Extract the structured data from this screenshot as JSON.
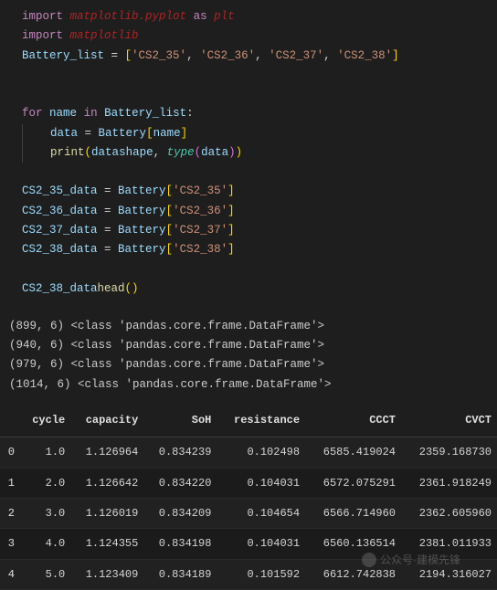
{
  "code": {
    "l1": {
      "import": "import",
      "mod": "matplotlib.pyplot",
      "as": "as",
      "alias": "plt"
    },
    "l2": {
      "import": "import",
      "mod": "matplotlib"
    },
    "l3": {
      "var": "Battery_list",
      "eq": " = ",
      "o": "[",
      "s1": "'CS2_35'",
      "c1": ", ",
      "s2": "'CS2_36'",
      "c2": ", ",
      "s3": "'CS2_37'",
      "c3": ", ",
      "s4": "'CS2_38'",
      "cbr": "]"
    },
    "l4": {
      "for": "for",
      "name": "name",
      "in": "in",
      "iter": "Battery_list",
      ":": ":"
    },
    "l5": {
      "varL": "data",
      "eq": " = ",
      "varR": "Battery",
      "o": "[",
      "idx": "name",
      "c": "]"
    },
    "l6": {
      "fn": "print",
      "o": "(",
      "d": "data",
      ".": ".",
      "attr": "shape",
      ", ": ", ",
      "ty": "type",
      "o2": "(",
      "d2": "data",
      "c2": ")",
      "c": ")"
    },
    "l7": {
      "var": "CS2_35_data",
      "eq": " = ",
      "r": "Battery",
      "o": "[",
      "s": "'CS2_35'",
      "c": "]"
    },
    "l8": {
      "var": "CS2_36_data",
      "eq": " = ",
      "r": "Battery",
      "o": "[",
      "s": "'CS2_36'",
      "c": "]"
    },
    "l9": {
      "var": "CS2_37_data",
      "eq": " = ",
      "r": "Battery",
      "o": "[",
      "s": "'CS2_37'",
      "c": "]"
    },
    "l10": {
      "var": "CS2_38_data",
      "eq": " = ",
      "r": "Battery",
      "o": "[",
      "s": "'CS2_38'",
      "c": "]"
    },
    "l11": {
      "var": "CS2_38_data",
      ".": ".",
      "fn": "head",
      "o": "(",
      "c": ")"
    }
  },
  "output": {
    "o1": "(899, 6) <class 'pandas.core.frame.DataFrame'>",
    "o2": "(940, 6) <class 'pandas.core.frame.DataFrame'>",
    "o3": "(979, 6) <class 'pandas.core.frame.DataFrame'>",
    "o4": "(1014, 6) <class 'pandas.core.frame.DataFrame'>"
  },
  "table": {
    "headers": [
      "",
      "cycle",
      "capacity",
      "SoH",
      "resistance",
      "CCCT",
      "CVCT"
    ],
    "rows": [
      [
        "0",
        "1.0",
        "1.126964",
        "0.834239",
        "0.102498",
        "6585.419024",
        "2359.168730"
      ],
      [
        "1",
        "2.0",
        "1.126642",
        "0.834220",
        "0.104031",
        "6572.075291",
        "2361.918249"
      ],
      [
        "2",
        "3.0",
        "1.126019",
        "0.834209",
        "0.104654",
        "6566.714960",
        "2362.605960"
      ],
      [
        "3",
        "4.0",
        "1.124355",
        "0.834198",
        "0.104031",
        "6560.136514",
        "2381.011933"
      ],
      [
        "4",
        "5.0",
        "1.123409",
        "0.834189",
        "0.101592",
        "6612.742838",
        "2194.316027"
      ]
    ]
  },
  "watermark": {
    "text": "公众号·建模先锋"
  }
}
